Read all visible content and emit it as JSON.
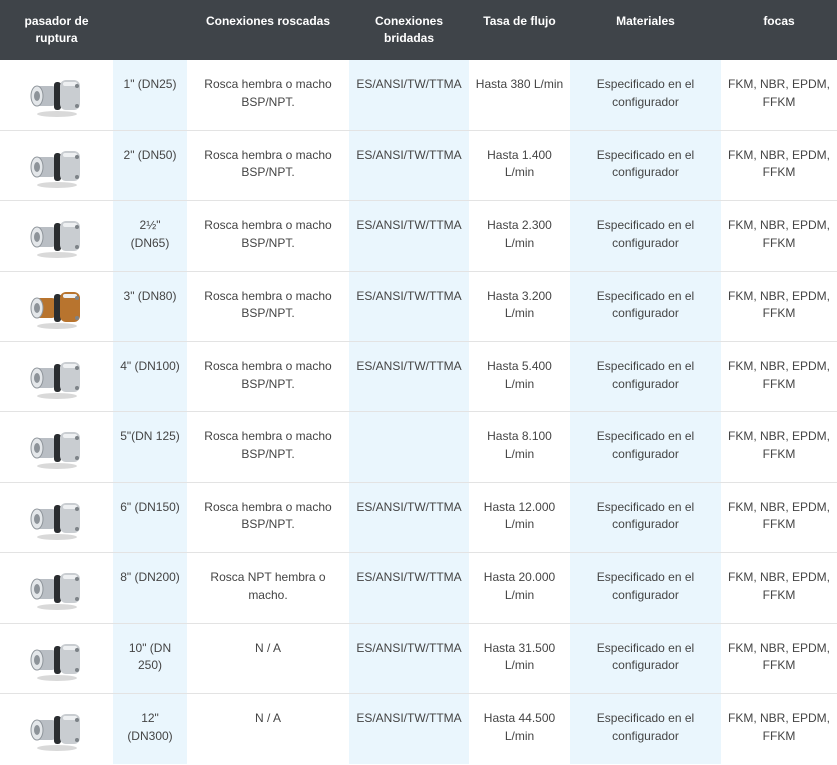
{
  "headers": [
    "pasador de ruptura",
    "",
    "Conexiones roscadas",
    "Conexiones bridadas",
    "Tasa de flujo",
    "Materiales",
    "focas"
  ],
  "rows": [
    {
      "image": "breakaway-coupling-icon",
      "size": "1\" (DN25)",
      "threaded": "Rosca hembra o macho BSP/NPT.",
      "flanged": "ES/ANSI/TW/TTMA",
      "flow": "Hasta 380 L/min",
      "materials": "Especificado en el configurador",
      "seals": "FKM, NBR, EPDM, FFKM"
    },
    {
      "image": "breakaway-coupling-icon",
      "size": "2\" (DN50)",
      "threaded": "Rosca hembra o macho BSP/NPT.",
      "flanged": "ES/ANSI/TW/TTMA",
      "flow": "Hasta 1.400 L/min",
      "materials": "Especificado en el configurador",
      "seals": "FKM, NBR, EPDM, FFKM"
    },
    {
      "image": "breakaway-coupling-icon",
      "size": "2½\" (DN65)",
      "threaded": "Rosca hembra o macho BSP/NPT.",
      "flanged": "ES/ANSI/TW/TTMA",
      "flow": "Hasta 2.300 L/min",
      "materials": "Especificado en el configurador",
      "seals": "FKM, NBR, EPDM, FFKM"
    },
    {
      "image": "breakaway-coupling-icon",
      "size": "3\" (DN80)",
      "threaded": "Rosca hembra o macho BSP/NPT.",
      "flanged": "ES/ANSI/TW/TTMA",
      "flow": "Hasta 3.200 L/min",
      "materials": "Especificado en el configurador",
      "seals": "FKM, NBR, EPDM, FFKM"
    },
    {
      "image": "breakaway-coupling-icon",
      "size": "4\" (DN100)",
      "threaded": "Rosca hembra o macho BSP/NPT.",
      "flanged": "ES/ANSI/TW/TTMA",
      "flow": "Hasta 5.400 L/min",
      "materials": "Especificado en el configurador",
      "seals": "FKM, NBR, EPDM, FFKM"
    },
    {
      "image": "breakaway-coupling-icon",
      "size": "5\"(DN 125)",
      "threaded": "Rosca hembra o macho BSP/NPT.",
      "flanged": "",
      "flow": "Hasta 8.100 L/min",
      "materials": "Especificado en el configurador",
      "seals": "FKM, NBR, EPDM, FFKM"
    },
    {
      "image": "breakaway-coupling-icon",
      "size": "6\" (DN150)",
      "threaded": "Rosca hembra o macho BSP/NPT.",
      "flanged": "ES/ANSI/TW/TTMA",
      "flow": "Hasta 12.000 L/min",
      "materials": "Especificado en el configurador",
      "seals": "FKM, NBR, EPDM, FFKM"
    },
    {
      "image": "breakaway-coupling-icon",
      "size": "8\" (DN200)",
      "threaded": "Rosca NPT hembra o macho.",
      "flanged": "ES/ANSI/TW/TTMA",
      "flow": "Hasta 20.000 L/min",
      "materials": "Especificado en el configurador",
      "seals": "FKM, NBR, EPDM, FFKM"
    },
    {
      "image": "breakaway-coupling-icon",
      "size": "10\" (DN 250)",
      "threaded": "N / A",
      "flanged": "ES/ANSI/TW/TTMA",
      "flow": "Hasta 31.500 L/min",
      "materials": "Especificado en el configurador",
      "seals": "FKM, NBR, EPDM, FFKM"
    },
    {
      "image": "breakaway-coupling-icon",
      "size": "12\" (DN300)",
      "threaded": "N / A",
      "flanged": "ES/ANSI/TW/TTMA",
      "flow": "Hasta 44.500 L/min",
      "materials": "Especificado en el configurador",
      "seals": "FKM, NBR, EPDM, FFKM"
    }
  ],
  "colors": {
    "header_bg": "#3f4449",
    "header_text": "#ffffff",
    "highlight_column": "#eaf6fd",
    "bronze_part": "#b8742e"
  }
}
